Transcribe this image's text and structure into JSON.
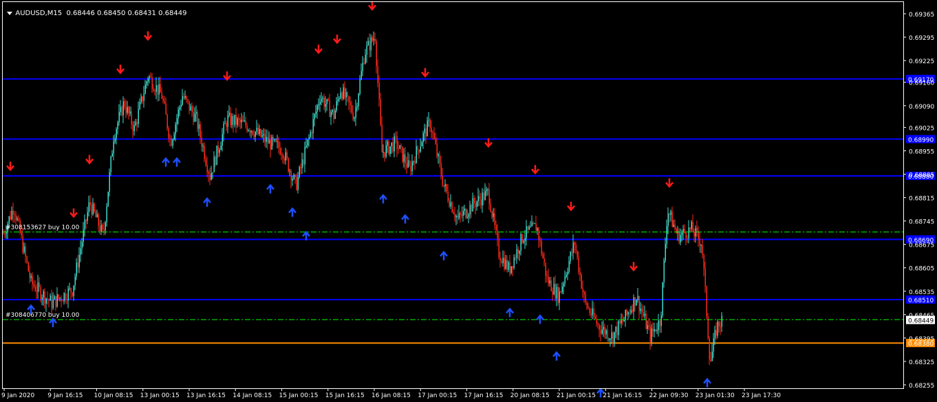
{
  "header": {
    "symbol": "AUDUSD,M15",
    "quote": "0.68446 0.68450 0.68431 0.68449"
  },
  "colors": {
    "background": "#000000",
    "frame": "#ffffff",
    "bull": "#40e0d0",
    "bear": "#ff2a1a",
    "level_line": "#0000ff",
    "order_line": "#00ff00",
    "sl_line": "#ff8c00",
    "arrow_up": "#1e50ff",
    "arrow_down": "#ff1a1a"
  },
  "chart_data": {
    "type": "candlestick",
    "symbol": "AUDUSD",
    "timeframe": "M15",
    "ylim": [
      0.68245,
      0.69395
    ],
    "y_ticks": [
      "0.69365",
      "0.69295",
      "0.69225",
      "0.69160",
      "0.69090",
      "0.69025",
      "0.68955",
      "0.68885",
      "0.68815",
      "0.68745",
      "0.68675",
      "0.68605",
      "0.68535",
      "0.68465",
      "0.68395",
      "0.68325",
      "0.68255"
    ],
    "y_tick_values": [
      0.69365,
      0.69295,
      0.69225,
      0.6916,
      0.6909,
      0.69025,
      0.68955,
      0.68885,
      0.68815,
      0.68745,
      0.68675,
      0.68605,
      0.68535,
      0.68465,
      0.68395,
      0.68325,
      0.68255
    ],
    "x_ticks": [
      "9 Jan 2020",
      "9 Jan 16:15",
      "10 Jan 08:15",
      "13 Jan 00:15",
      "13 Jan 16:15",
      "14 Jan 08:15",
      "15 Jan 00:15",
      "15 Jan 16:15",
      "16 Jan 08:15",
      "17 Jan 00:15",
      "17 Jan 16:15",
      "20 Jan 08:15",
      "21 Jan 00:15",
      "21 Jan 16:15",
      "22 Jan 09:30",
      "23 Jan 01:30",
      "23 Jan 17:30"
    ],
    "price_path": [
      [
        0,
        0.6868
      ],
      [
        20,
        0.6879
      ],
      [
        45,
        0.6856
      ],
      [
        75,
        0.685
      ],
      [
        105,
        0.6854
      ],
      [
        130,
        0.688
      ],
      [
        150,
        0.687
      ],
      [
        165,
        0.69
      ],
      [
        180,
        0.691
      ],
      [
        195,
        0.6902
      ],
      [
        215,
        0.6918
      ],
      [
        235,
        0.6912
      ],
      [
        248,
        0.6898
      ],
      [
        265,
        0.6912
      ],
      [
        285,
        0.6905
      ],
      [
        305,
        0.6888
      ],
      [
        330,
        0.6905
      ],
      [
        360,
        0.6903
      ],
      [
        390,
        0.6898
      ],
      [
        410,
        0.6896
      ],
      [
        430,
        0.6885
      ],
      [
        450,
        0.69
      ],
      [
        465,
        0.6912
      ],
      [
        485,
        0.6906
      ],
      [
        495,
        0.6914
      ],
      [
        515,
        0.6906
      ],
      [
        530,
        0.6925
      ],
      [
        545,
        0.693
      ],
      [
        555,
        0.6895
      ],
      [
        575,
        0.6898
      ],
      [
        595,
        0.689
      ],
      [
        615,
        0.69
      ],
      [
        625,
        0.6904
      ],
      [
        645,
        0.6885
      ],
      [
        665,
        0.6875
      ],
      [
        690,
        0.688
      ],
      [
        710,
        0.6883
      ],
      [
        725,
        0.6865
      ],
      [
        740,
        0.686
      ],
      [
        760,
        0.687
      ],
      [
        780,
        0.6873
      ],
      [
        795,
        0.6857
      ],
      [
        812,
        0.6852
      ],
      [
        835,
        0.6868
      ],
      [
        850,
        0.685
      ],
      [
        870,
        0.6843
      ],
      [
        890,
        0.684
      ],
      [
        910,
        0.6846
      ],
      [
        925,
        0.6852
      ],
      [
        945,
        0.684
      ],
      [
        960,
        0.6845
      ],
      [
        970,
        0.6878
      ],
      [
        985,
        0.687
      ],
      [
        1005,
        0.6872
      ],
      [
        1020,
        0.6868
      ],
      [
        1032,
        0.6832
      ],
      [
        1042,
        0.6843
      ],
      [
        1050,
        0.6845
      ]
    ],
    "horizontal_levels": [
      {
        "price": 0.6917,
        "tag": "0.69170",
        "color": "#0000ff"
      },
      {
        "price": 0.6899,
        "tag": "0.68990",
        "color": "#0000ff"
      },
      {
        "price": 0.6888,
        "tag": "0.68880",
        "color": "#0000ff"
      },
      {
        "price": 0.6869,
        "tag": "0.68690",
        "color": "#0000ff"
      },
      {
        "price": 0.6851,
        "tag": "0.68510",
        "color": "#0000ff"
      },
      {
        "price": 0.6838,
        "tag": "0.68380",
        "color": "#ff8c00"
      }
    ],
    "current_price": {
      "price": 0.68449,
      "tag": "0.68449"
    },
    "orders": [
      {
        "label": "#308153627 buy 10.00",
        "price": 0.68712
      },
      {
        "label": "#308406770 buy 10.00",
        "price": 0.6845
      }
    ],
    "signals": [
      {
        "dir": "down",
        "x": 15,
        "price": 0.689
      },
      {
        "dir": "down",
        "x": 107,
        "price": 0.6876
      },
      {
        "dir": "down",
        "x": 130,
        "price": 0.6892
      },
      {
        "dir": "down",
        "x": 175,
        "price": 0.6919
      },
      {
        "dir": "down",
        "x": 215,
        "price": 0.6929
      },
      {
        "dir": "down",
        "x": 330,
        "price": 0.6917
      },
      {
        "dir": "down",
        "x": 463,
        "price": 0.6925
      },
      {
        "dir": "down",
        "x": 490,
        "price": 0.6928
      },
      {
        "dir": "down",
        "x": 541,
        "price": 0.6938
      },
      {
        "dir": "down",
        "x": 618,
        "price": 0.6918
      },
      {
        "dir": "down",
        "x": 710,
        "price": 0.6897
      },
      {
        "dir": "down",
        "x": 778,
        "price": 0.6889
      },
      {
        "dir": "down",
        "x": 830,
        "price": 0.6878
      },
      {
        "dir": "down",
        "x": 921,
        "price": 0.686
      },
      {
        "dir": "down",
        "x": 973,
        "price": 0.6885
      },
      {
        "dir": "up",
        "x": 45,
        "price": 0.6849
      },
      {
        "dir": "up",
        "x": 77,
        "price": 0.6845
      },
      {
        "dir": "up",
        "x": 241,
        "price": 0.6893
      },
      {
        "dir": "up",
        "x": 257,
        "price": 0.6893
      },
      {
        "dir": "up",
        "x": 301,
        "price": 0.6881
      },
      {
        "dir": "up",
        "x": 393,
        "price": 0.6885
      },
      {
        "dir": "up",
        "x": 425,
        "price": 0.6878
      },
      {
        "dir": "up",
        "x": 445,
        "price": 0.6871
      },
      {
        "dir": "up",
        "x": 557,
        "price": 0.6882
      },
      {
        "dir": "up",
        "x": 589,
        "price": 0.6876
      },
      {
        "dir": "up",
        "x": 645,
        "price": 0.6865
      },
      {
        "dir": "up",
        "x": 741,
        "price": 0.6848
      },
      {
        "dir": "up",
        "x": 785,
        "price": 0.6846
      },
      {
        "dir": "up",
        "x": 809,
        "price": 0.6835
      },
      {
        "dir": "up",
        "x": 873,
        "price": 0.6824
      },
      {
        "dir": "up",
        "x": 1028,
        "price": 0.6827
      }
    ]
  }
}
